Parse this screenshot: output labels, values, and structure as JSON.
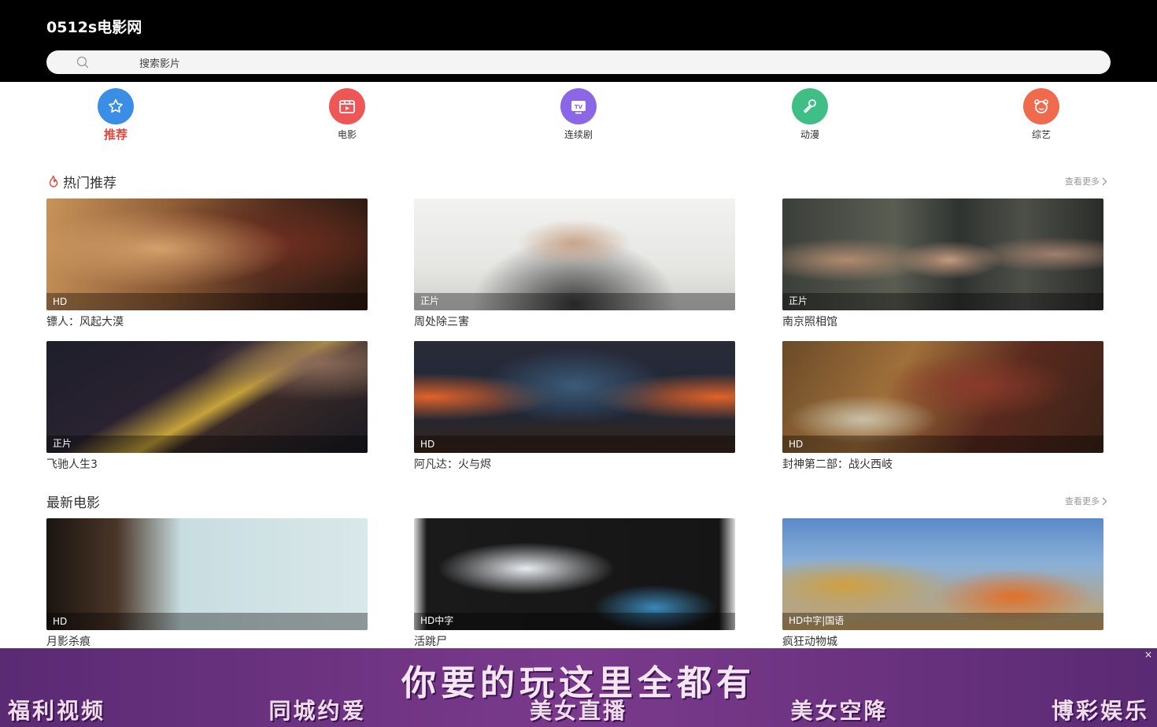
{
  "site": {
    "title": "0512s电影网"
  },
  "search": {
    "placeholder": "搜索影片"
  },
  "nav": [
    {
      "label": "推荐",
      "icon": "star-icon",
      "color": "#3a8ee6",
      "active": true
    },
    {
      "label": "电影",
      "icon": "clapperboard-icon",
      "color": "#ef5757",
      "active": false
    },
    {
      "label": "连续剧",
      "icon": "tv-icon",
      "color": "#8b67e8",
      "active": false
    },
    {
      "label": "动漫",
      "icon": "microphone-icon",
      "color": "#3fbf86",
      "active": false
    },
    {
      "label": "综艺",
      "icon": "bear-face-icon",
      "color": "#f06a4e",
      "active": false
    }
  ],
  "sections": [
    {
      "title": "热门推荐",
      "more": "查看更多",
      "items": [
        {
          "title": "镖人：风起大漠",
          "badge": "HD"
        },
        {
          "title": "周处除三害",
          "badge": "正片"
        },
        {
          "title": "南京照相馆",
          "badge": "正片"
        },
        {
          "title": "飞驰人生3",
          "badge": "正片"
        },
        {
          "title": "阿凡达：火与烬",
          "badge": "HD"
        },
        {
          "title": "封神第二部：战火西岐",
          "badge": "HD"
        }
      ]
    },
    {
      "title": "最新电影",
      "more": "查看更多",
      "items": [
        {
          "title": "月影杀痕",
          "badge": "HD"
        },
        {
          "title": "活跳尸",
          "badge": "HD中字"
        },
        {
          "title": "疯狂动物城",
          "badge": "HD中字|国语"
        }
      ]
    }
  ],
  "ad": {
    "headline": "你要的玩这里全都有",
    "items": [
      "福利视频",
      "同城约爱",
      "美女直播",
      "美女空降",
      "博彩娱乐"
    ],
    "close": "×"
  },
  "colors": {
    "accent": "#e2463c",
    "header_bg": "#000000"
  }
}
